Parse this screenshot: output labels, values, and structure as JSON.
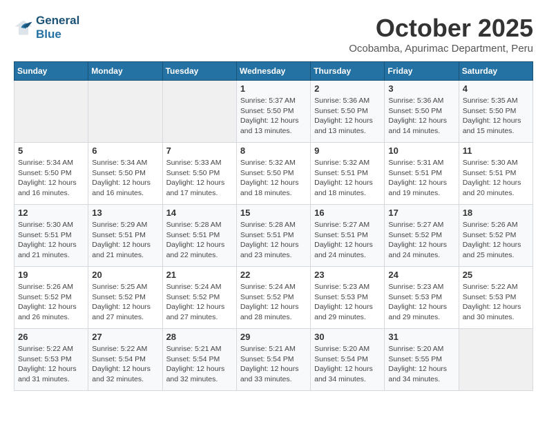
{
  "logo": {
    "line1": "General",
    "line2": "Blue"
  },
  "title": "October 2025",
  "subtitle": "Ocobamba, Apurimac Department, Peru",
  "weekdays": [
    "Sunday",
    "Monday",
    "Tuesday",
    "Wednesday",
    "Thursday",
    "Friday",
    "Saturday"
  ],
  "weeks": [
    [
      {
        "day": "",
        "info": ""
      },
      {
        "day": "",
        "info": ""
      },
      {
        "day": "",
        "info": ""
      },
      {
        "day": "1",
        "info": "Sunrise: 5:37 AM\nSunset: 5:50 PM\nDaylight: 12 hours\nand 13 minutes."
      },
      {
        "day": "2",
        "info": "Sunrise: 5:36 AM\nSunset: 5:50 PM\nDaylight: 12 hours\nand 13 minutes."
      },
      {
        "day": "3",
        "info": "Sunrise: 5:36 AM\nSunset: 5:50 PM\nDaylight: 12 hours\nand 14 minutes."
      },
      {
        "day": "4",
        "info": "Sunrise: 5:35 AM\nSunset: 5:50 PM\nDaylight: 12 hours\nand 15 minutes."
      }
    ],
    [
      {
        "day": "5",
        "info": "Sunrise: 5:34 AM\nSunset: 5:50 PM\nDaylight: 12 hours\nand 16 minutes."
      },
      {
        "day": "6",
        "info": "Sunrise: 5:34 AM\nSunset: 5:50 PM\nDaylight: 12 hours\nand 16 minutes."
      },
      {
        "day": "7",
        "info": "Sunrise: 5:33 AM\nSunset: 5:50 PM\nDaylight: 12 hours\nand 17 minutes."
      },
      {
        "day": "8",
        "info": "Sunrise: 5:32 AM\nSunset: 5:50 PM\nDaylight: 12 hours\nand 18 minutes."
      },
      {
        "day": "9",
        "info": "Sunrise: 5:32 AM\nSunset: 5:51 PM\nDaylight: 12 hours\nand 18 minutes."
      },
      {
        "day": "10",
        "info": "Sunrise: 5:31 AM\nSunset: 5:51 PM\nDaylight: 12 hours\nand 19 minutes."
      },
      {
        "day": "11",
        "info": "Sunrise: 5:30 AM\nSunset: 5:51 PM\nDaylight: 12 hours\nand 20 minutes."
      }
    ],
    [
      {
        "day": "12",
        "info": "Sunrise: 5:30 AM\nSunset: 5:51 PM\nDaylight: 12 hours\nand 21 minutes."
      },
      {
        "day": "13",
        "info": "Sunrise: 5:29 AM\nSunset: 5:51 PM\nDaylight: 12 hours\nand 21 minutes."
      },
      {
        "day": "14",
        "info": "Sunrise: 5:28 AM\nSunset: 5:51 PM\nDaylight: 12 hours\nand 22 minutes."
      },
      {
        "day": "15",
        "info": "Sunrise: 5:28 AM\nSunset: 5:51 PM\nDaylight: 12 hours\nand 23 minutes."
      },
      {
        "day": "16",
        "info": "Sunrise: 5:27 AM\nSunset: 5:51 PM\nDaylight: 12 hours\nand 24 minutes."
      },
      {
        "day": "17",
        "info": "Sunrise: 5:27 AM\nSunset: 5:52 PM\nDaylight: 12 hours\nand 24 minutes."
      },
      {
        "day": "18",
        "info": "Sunrise: 5:26 AM\nSunset: 5:52 PM\nDaylight: 12 hours\nand 25 minutes."
      }
    ],
    [
      {
        "day": "19",
        "info": "Sunrise: 5:26 AM\nSunset: 5:52 PM\nDaylight: 12 hours\nand 26 minutes."
      },
      {
        "day": "20",
        "info": "Sunrise: 5:25 AM\nSunset: 5:52 PM\nDaylight: 12 hours\nand 27 minutes."
      },
      {
        "day": "21",
        "info": "Sunrise: 5:24 AM\nSunset: 5:52 PM\nDaylight: 12 hours\nand 27 minutes."
      },
      {
        "day": "22",
        "info": "Sunrise: 5:24 AM\nSunset: 5:52 PM\nDaylight: 12 hours\nand 28 minutes."
      },
      {
        "day": "23",
        "info": "Sunrise: 5:23 AM\nSunset: 5:53 PM\nDaylight: 12 hours\nand 29 minutes."
      },
      {
        "day": "24",
        "info": "Sunrise: 5:23 AM\nSunset: 5:53 PM\nDaylight: 12 hours\nand 29 minutes."
      },
      {
        "day": "25",
        "info": "Sunrise: 5:22 AM\nSunset: 5:53 PM\nDaylight: 12 hours\nand 30 minutes."
      }
    ],
    [
      {
        "day": "26",
        "info": "Sunrise: 5:22 AM\nSunset: 5:53 PM\nDaylight: 12 hours\nand 31 minutes."
      },
      {
        "day": "27",
        "info": "Sunrise: 5:22 AM\nSunset: 5:54 PM\nDaylight: 12 hours\nand 32 minutes."
      },
      {
        "day": "28",
        "info": "Sunrise: 5:21 AM\nSunset: 5:54 PM\nDaylight: 12 hours\nand 32 minutes."
      },
      {
        "day": "29",
        "info": "Sunrise: 5:21 AM\nSunset: 5:54 PM\nDaylight: 12 hours\nand 33 minutes."
      },
      {
        "day": "30",
        "info": "Sunrise: 5:20 AM\nSunset: 5:54 PM\nDaylight: 12 hours\nand 34 minutes."
      },
      {
        "day": "31",
        "info": "Sunrise: 5:20 AM\nSunset: 5:55 PM\nDaylight: 12 hours\nand 34 minutes."
      },
      {
        "day": "",
        "info": ""
      }
    ]
  ]
}
